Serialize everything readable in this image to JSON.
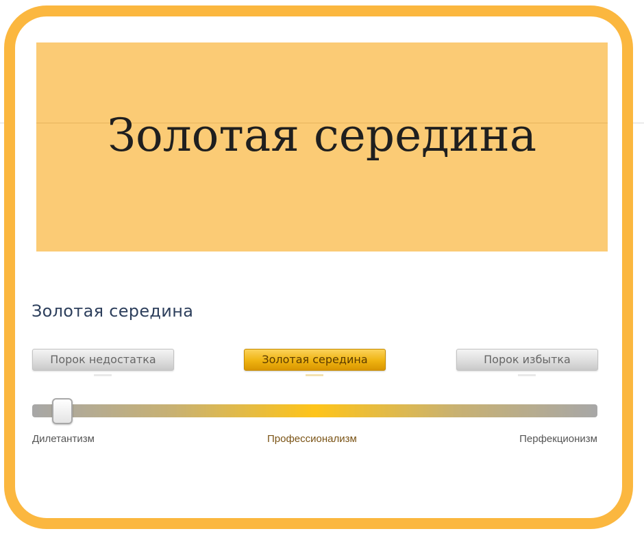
{
  "banner": {
    "title": "Золотая середина",
    "background_color": "#fbcb75"
  },
  "frame": {
    "border_color": "#fbb73f"
  },
  "section": {
    "title": "Золотая середина"
  },
  "buttons": [
    {
      "label": "Порок недостатка",
      "style": "gray"
    },
    {
      "label": "Золотая середина",
      "style": "gold",
      "selected": true
    },
    {
      "label": "Порок избытка",
      "style": "gray"
    }
  ],
  "slider": {
    "value_fraction": 0.06,
    "track_colors": [
      "#a7a7a7",
      "#fec41a",
      "#a7a7a7"
    ],
    "labels": {
      "left": "Дилетантизм",
      "middle": "Профессионализм",
      "right": "Перфекционизм"
    }
  }
}
